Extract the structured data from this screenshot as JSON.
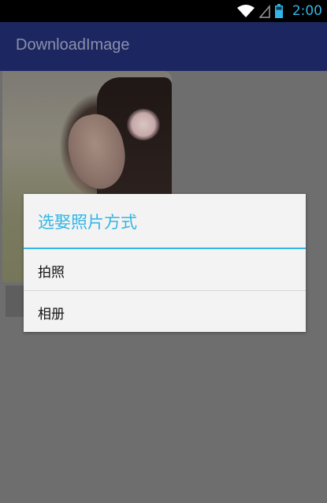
{
  "status_bar": {
    "time": "2:00",
    "icons": [
      "wifi-icon",
      "signal-icon",
      "battery-icon"
    ],
    "accent_color": "#33b5e5"
  },
  "action_bar": {
    "title": "DownloadImage",
    "background": "#1c2762"
  },
  "dialog": {
    "title": "选娶照片方式",
    "title_color": "#33b5e5",
    "items": [
      {
        "label": "拍照"
      },
      {
        "label": "相册"
      }
    ]
  }
}
